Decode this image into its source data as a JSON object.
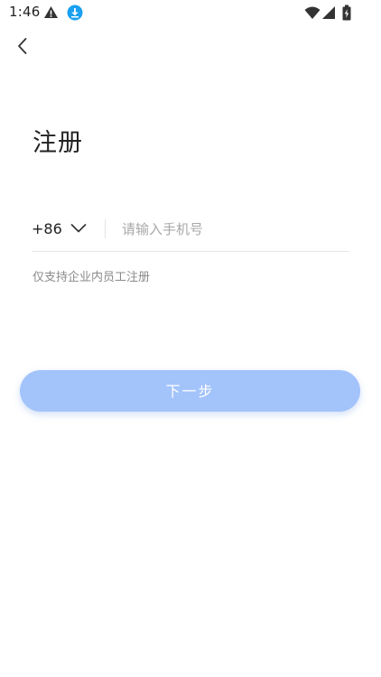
{
  "status_bar": {
    "time": "1:46",
    "left_icons": [
      "warning-icon",
      "download-icon"
    ],
    "right_icons": [
      "wifi-icon",
      "signal-icon",
      "battery-icon"
    ],
    "download_icon_color": "#1aa0f0"
  },
  "nav": {
    "back_icon": "chevron-left-icon"
  },
  "page": {
    "title": "注册"
  },
  "phone": {
    "country_code": "+86",
    "country_chevron_icon": "chevron-down-icon",
    "input_value": "",
    "input_placeholder": "请输入手机号"
  },
  "hint": "仅支持企业内员工注册",
  "actions": {
    "next_label": "下一步",
    "next_color": "#a3c3fb",
    "next_enabled": false
  }
}
